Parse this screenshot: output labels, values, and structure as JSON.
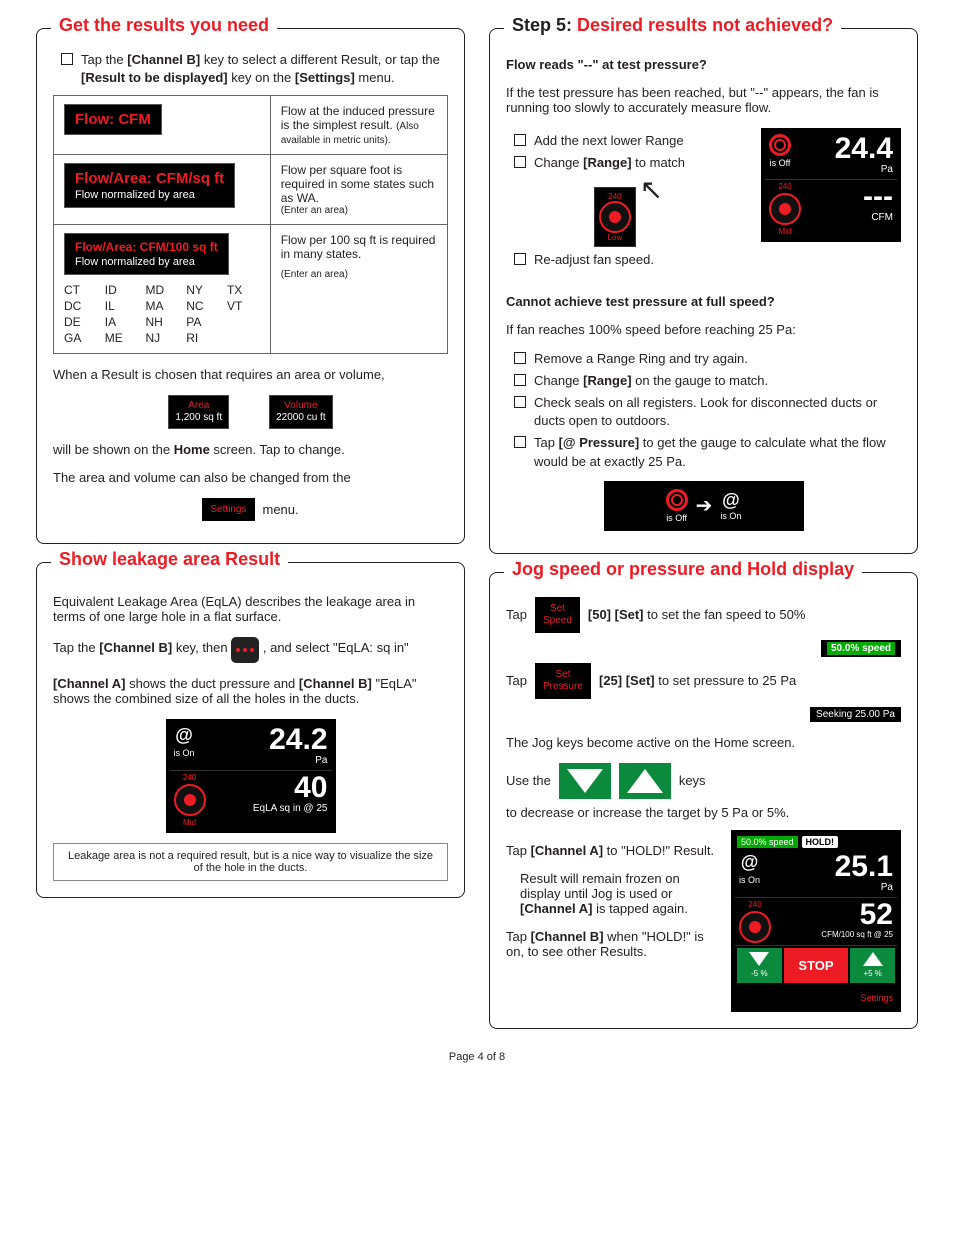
{
  "footer": "Page 4 of 8",
  "left": {
    "panel1": {
      "title": "Get the results you need",
      "check1_pre": "Tap the ",
      "check1_b1": "[Channel B]",
      "check1_mid": " key to select a different Result, or tap the ",
      "check1_b2": "[Result to be displayed]",
      "check1_mid2": " key on the ",
      "check1_b3": "[Settings]",
      "check1_end": " menu.",
      "row1_lcd": "Flow: CFM",
      "row1_desc_a": "Flow at the induced pressure is the simplest result. ",
      "row1_desc_b": "(Also available in metric units).",
      "row2_lcd": "Flow/Area: CFM/sq ft",
      "row2_sub": "Flow normalized by area",
      "row2_desc_a": "Flow per square foot is required in some states such as WA.",
      "row2_desc_b": "(Enter an area)",
      "row3_lcd": "Flow/Area: CFM/100 sq ft",
      "row3_sub": "Flow normalized by area",
      "row3_desc_a": "Flow per 100 sq ft is required in many states.",
      "row3_desc_b": "(Enter an area)",
      "states": [
        "CT",
        "ID",
        "MD",
        "NY",
        "TX",
        "DC",
        "IL",
        "MA",
        "NC",
        "VT",
        "DE",
        "IA",
        "NH",
        "PA",
        "",
        "GA",
        "ME",
        "NJ",
        "RI",
        ""
      ],
      "p_area": "When a Result is chosen that requires an area or volume,",
      "area_label": "Area",
      "area_val": "1,200 sq ft",
      "vol_label": "Volume",
      "vol_val": "22000 cu ft",
      "p_home_a": "will be shown on the ",
      "p_home_b": "Home",
      "p_home_c": " screen.  Tap to change.",
      "p_chg": "The area and volume can also be changed from the",
      "settings_btn": "Settings",
      "menu_word": "menu."
    },
    "panel2": {
      "title": "Show leakage area Result",
      "p1": "Equivalent Leakage Area (EqLA) describes the leakage area in terms of one large hole in a flat surface.",
      "p2_a": "Tap the ",
      "p2_b": "[Channel B]",
      "p2_c": " key, then ",
      "p2_d": ", and select \"EqLA: sq in\"",
      "p3_a": "[Channel A]",
      "p3_b": " shows the duct pressure and ",
      "p3_c": "[Channel B]",
      "p3_d": " \"EqLA\" shows the combined size of all the holes in the ducts.",
      "g_isOn": "is On",
      "g_240": "240",
      "g_mid": "Mid",
      "g_v1": "24.2",
      "g_u1": "Pa",
      "g_v2": "40",
      "g_u2": "EqLA sq in @ 25",
      "note": "Leakage area is not a required result, but is a nice way to visualize the size of the hole in the ducts."
    }
  },
  "right": {
    "panel1": {
      "title_pre": "Step 5: ",
      "title": "Desired results not achieved?",
      "h1": "Flow reads \"--\" at test pressure?",
      "p1": "If the test pressure has been reached, but \"--\" appears, the fan is running too slowly to accurately measure flow.",
      "c1": "Add the next lower Range",
      "c2_a": "Change ",
      "c2_b": "[Range]",
      "c2_c": " to match",
      "c3": "Re-adjust fan speed.",
      "g_v1": "24.4",
      "g_u1": "Pa",
      "g_v2": "---",
      "g_u2": "CFM",
      "g_isOff": "is Off",
      "g_240": "240",
      "g_mid": "Mid",
      "g_low": "Low",
      "h2": "Cannot achieve test pressure at full speed?",
      "p2": "If fan reaches 100% speed before reaching 25 Pa:",
      "d1": "Remove a Range Ring and try again.",
      "d2_a": "Change ",
      "d2_b": "[Range]",
      "d2_c": " on the gauge to match.",
      "d3": "Check seals on all registers. Look for disconnected ducts or ducts open to outdoors.",
      "d4_a": "Tap ",
      "d4_b": "[@ Pressure]",
      "d4_c": " to get the gauge to calculate what the flow would be at exactly 25 Pa.",
      "isOff": "is Off",
      "isOn": "is On"
    },
    "panel2": {
      "title": "Jog speed or pressure and Hold display",
      "r1_a": "Tap",
      "r1_btn": "Set\nSpeed",
      "r1_b": "[50] [Set]",
      "r1_c": " to set the fan speed to 50%",
      "bar1": "50.0% speed",
      "r2_a": "Tap",
      "r2_btn": "Set\nPressure",
      "r2_b": "[25] [Set]",
      "r2_c": " to set pressure to 25 Pa",
      "bar2": "Seeking 25.00 Pa",
      "p_jog": "The Jog keys become active on the Home screen.",
      "use_a": "Use the",
      "use_b": "keys",
      "use_c": "to decrease or increase the target by 5 Pa or 5%.",
      "hold_a": "Tap ",
      "hold_b": "[Channel A]",
      "hold_c": " to \"HOLD!\" Result.",
      "freeze_a": "Result will remain frozen on display until Jog is used or ",
      "freeze_b": "[Channel A]",
      "freeze_c": " is tapped again.",
      "cb_a": "Tap ",
      "cb_b": "[Channel B]",
      "cb_c": " when \"HOLD!\" is on, to see other Results.",
      "g_speed": "50.0% speed",
      "g_hold": "HOLD!",
      "g_isOn": "is On",
      "g_240": "240",
      "g_v1": "25.1",
      "g_u1": "Pa",
      "g_v2": "52",
      "g_u2": "CFM/100 sq ft @ 25",
      "stop": "STOP",
      "minus5": "-5 %",
      "plus5": "+5 %",
      "settings": "Settings"
    }
  }
}
